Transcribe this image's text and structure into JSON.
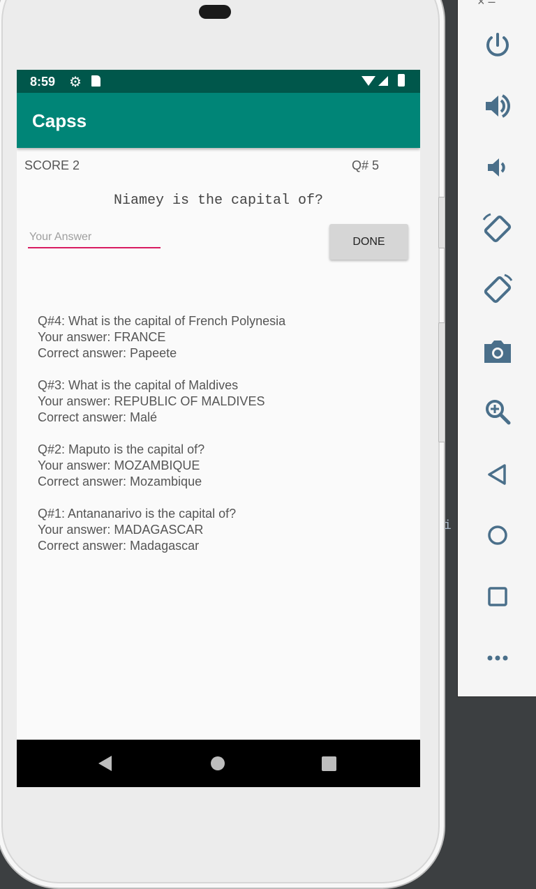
{
  "status_bar": {
    "time": "8:59",
    "icons": [
      "gear-icon",
      "sd-card-icon",
      "wifi-icon",
      "signal-icon",
      "battery-icon"
    ]
  },
  "app_bar": {
    "title": "Capss"
  },
  "score_label": "SCORE 2",
  "question_number": "Q# 5",
  "question": "Niamey is the capital of?",
  "answer_input": {
    "placeholder": "Your Answer",
    "value": ""
  },
  "done_label": "DONE",
  "history": [
    {
      "question": "Q#4: What is the capital of French Polynesia",
      "your_answer": "Your answer: FRANCE",
      "correct_answer": "Correct answer: Papeete"
    },
    {
      "question": "Q#3: What is the capital of Maldives",
      "your_answer": "Your answer: REPUBLIC OF MALDIVES",
      "correct_answer": "Correct answer: Malé"
    },
    {
      "question": "Q#2: Maputo is the capital of?",
      "your_answer": "Your answer: MOZAMBIQUE",
      "correct_answer": "Correct answer: Mozambique"
    },
    {
      "question": "Q#1: Antananarivo is the capital of?",
      "your_answer": "Your answer: MADAGASCAR",
      "correct_answer": "Correct answer: Madagascar"
    }
  ],
  "emulator_toolbar": {
    "buttons": [
      "power-icon",
      "volume-up-icon",
      "volume-down-icon",
      "rotate-left-icon",
      "rotate-right-icon",
      "camera-icon",
      "zoom-icon",
      "back-icon",
      "home-icon",
      "overview-icon",
      "more-icon"
    ],
    "top_controls": "×  –"
  },
  "ide_fragment": "i",
  "colors": {
    "status_bar": "#00574b",
    "app_bar": "#008577",
    "accent": "#d81b60"
  }
}
